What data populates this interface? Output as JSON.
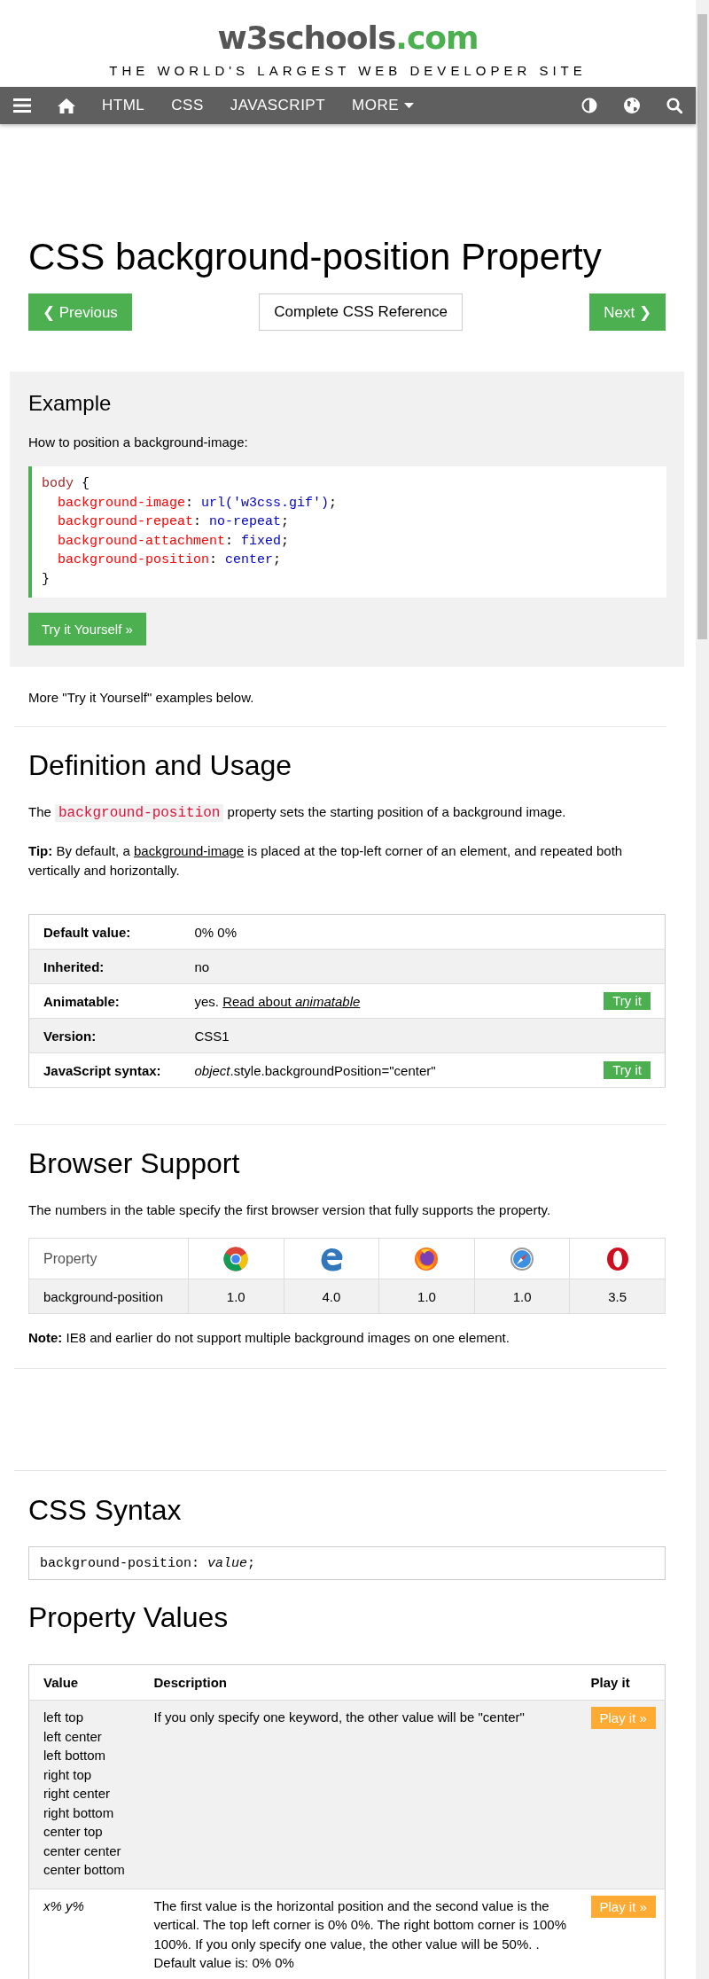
{
  "header": {
    "logo": {
      "name": "w3schools",
      "domain": ".com"
    },
    "tagline": "THE WORLD'S LARGEST WEB DEVELOPER SITE"
  },
  "nav": {
    "links": [
      "HTML",
      "CSS",
      "JAVASCRIPT"
    ],
    "more": "MORE"
  },
  "page": {
    "title": "CSS background-position Property",
    "previous": "❮ Previous",
    "reference": "Complete CSS Reference",
    "next": "Next ❯"
  },
  "example": {
    "heading": "Example",
    "intro": "How to position a background-image:",
    "code": [
      {
        "indented": false,
        "tokens": [
          {
            "kind": "selector",
            "text": "body"
          },
          {
            "kind": "punct",
            "text": " {"
          }
        ]
      },
      {
        "indented": true,
        "tokens": [
          {
            "kind": "property",
            "text": "background-image"
          },
          {
            "kind": "punct",
            "text": ": "
          },
          {
            "kind": "value",
            "text": "url('w3css.gif')"
          },
          {
            "kind": "punct",
            "text": ";"
          }
        ]
      },
      {
        "indented": true,
        "tokens": [
          {
            "kind": "property",
            "text": "background-repeat"
          },
          {
            "kind": "punct",
            "text": ": "
          },
          {
            "kind": "value",
            "text": "no-repeat"
          },
          {
            "kind": "punct",
            "text": ";"
          }
        ]
      },
      {
        "indented": true,
        "tokens": [
          {
            "kind": "property",
            "text": "background-attachment"
          },
          {
            "kind": "punct",
            "text": ": "
          },
          {
            "kind": "value",
            "text": "fixed"
          },
          {
            "kind": "punct",
            "text": ";"
          }
        ]
      },
      {
        "indented": true,
        "tokens": [
          {
            "kind": "property",
            "text": "background-position"
          },
          {
            "kind": "punct",
            "text": ": "
          },
          {
            "kind": "value",
            "text": "center"
          },
          {
            "kind": "punct",
            "text": ";"
          }
        ]
      },
      {
        "indented": false,
        "tokens": [
          {
            "kind": "punct",
            "text": "}"
          }
        ]
      }
    ],
    "button": "Try it Yourself »"
  },
  "more_note": "More \"Try it Yourself\" examples below.",
  "definition": {
    "heading": "Definition and Usage",
    "text": {
      "before": "The ",
      "code": "background-position",
      "after": " property sets the starting position of a background image."
    },
    "tip": {
      "before": "**Tip:** By default, a ",
      "link": "background-image",
      "after": " is placed at the top-left corner of an element, and repeated both vertically and horizontally."
    },
    "properties": [
      {
        "label": "Default value:",
        "value": "0% 0%"
      },
      {
        "label": "Inherited:",
        "value": "no"
      },
      {
        "label": "Animatable:",
        "value": "yes.",
        "link": "Read about *animatable*",
        "button": "Try it"
      },
      {
        "label": "Version:",
        "value": "CSS1"
      },
      {
        "label": "JavaScript syntax:",
        "value": "*object*.style.backgroundPosition=\"center\"",
        "button": "Try it"
      }
    ]
  },
  "browser_support": {
    "heading": "Browser Support",
    "intro": "The numbers in the table specify the first browser version that fully supports the property.",
    "columns": [
      {
        "kind": "label",
        "label": "Property"
      },
      {
        "kind": "chrome"
      },
      {
        "kind": "edge"
      },
      {
        "kind": "firefox"
      },
      {
        "kind": "safari"
      },
      {
        "kind": "opera"
      }
    ],
    "rows": [
      {
        "cells": [
          "background-position",
          "1.0",
          "4.0",
          "1.0",
          "1.0",
          "3.5"
        ]
      }
    ],
    "note": "**Note:** IE8 and earlier do not support multiple background images on one element."
  },
  "syntax": {
    "heading": "CSS Syntax",
    "property": "background-position: ",
    "value": "value",
    "end": ";"
  },
  "property_values": {
    "heading": "Property Values",
    "columns": [
      "Value",
      "Description",
      "Play it"
    ],
    "rows": [
      {
        "italic": false,
        "values": [
          "left top",
          "left center",
          "left bottom",
          "right top",
          "right center",
          "right bottom",
          "center top",
          "center center",
          "center bottom"
        ],
        "description": "If you only specify one keyword, the other value will be \"center\"",
        "button": "Play it »"
      },
      {
        "italic": true,
        "values": [
          "x% y%"
        ],
        "description": "The first value is the horizontal position and the second value is the vertical. The top left corner is 0% 0%. The right bottom corner is 100% 100%. If you only specify one value, the other value will be 50%. . Default value is: 0% 0%",
        "button": "Play it »"
      }
    ]
  }
}
